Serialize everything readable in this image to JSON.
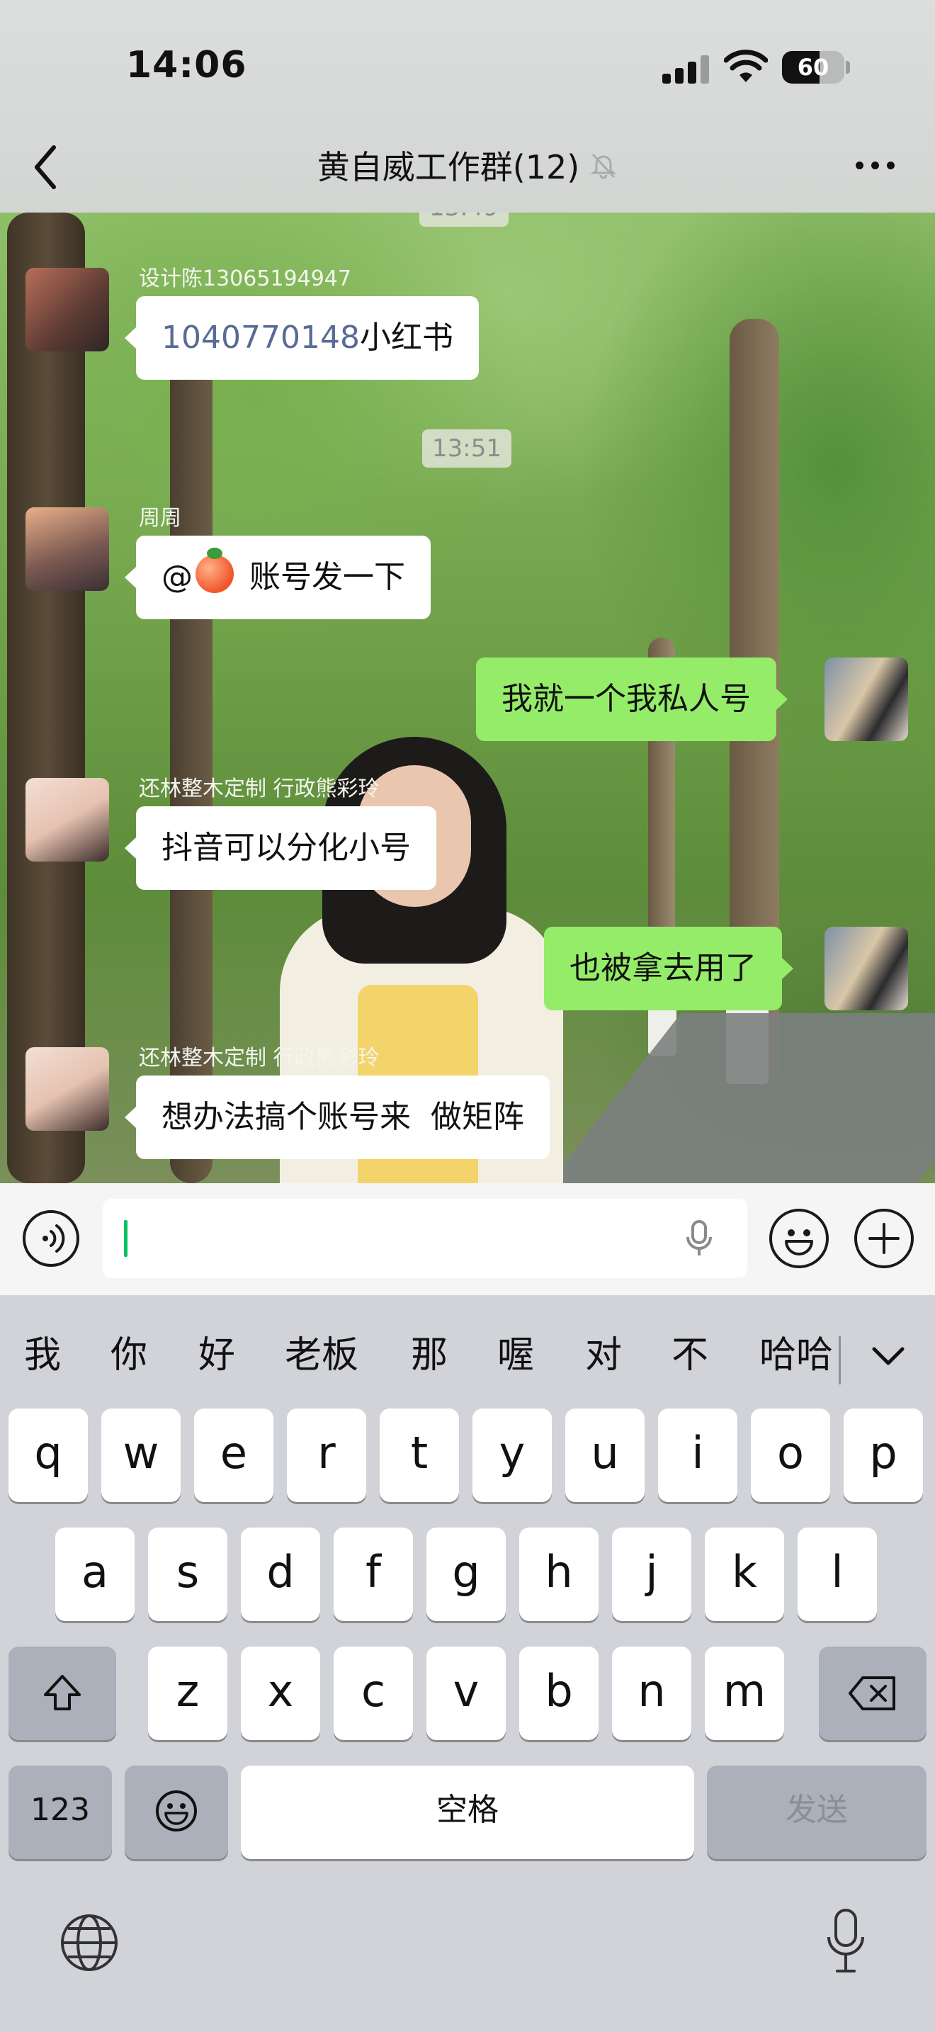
{
  "status_bar": {
    "time": "14:06",
    "battery": "60"
  },
  "header": {
    "title": "黄自威工作群(12)"
  },
  "messages": [
    {
      "sender": "设计陈13065194947",
      "text_link": "1040770148",
      "text": "小红书"
    },
    {
      "sender": "周周",
      "mention": "@",
      "text": " 账号发一下"
    },
    {
      "text": "我就一个我私人号"
    },
    {
      "sender": "还林整木定制 行政熊彩玲",
      "text": "抖音可以分化小号"
    },
    {
      "text": "也被拿去用了"
    },
    {
      "sender": "还林整木定制 行政熊彩玲",
      "text": "想办法搞个账号来  做矩阵"
    }
  ],
  "timestamps": {
    "top_partial": "13:49",
    "middle": "13:51"
  },
  "input": {
    "value": ""
  },
  "keyboard": {
    "candidates": [
      "我",
      "你",
      "好",
      "老板",
      "那",
      "喔",
      "对",
      "不",
      "哈哈"
    ],
    "row1": [
      "q",
      "w",
      "e",
      "r",
      "t",
      "y",
      "u",
      "i",
      "o",
      "p"
    ],
    "row2": [
      "a",
      "s",
      "d",
      "f",
      "g",
      "h",
      "j",
      "k",
      "l"
    ],
    "row3": [
      "z",
      "x",
      "c",
      "v",
      "b",
      "n",
      "m"
    ],
    "numbers_label": "123",
    "space_label": "空格",
    "send_label": "发送"
  },
  "colors": {
    "outgoing_bubble": "#95ec69",
    "incoming_bubble": "#ffffff",
    "link_text": "#576b95",
    "caret": "#07c160"
  },
  "icons": [
    "back-chevron-icon",
    "mute-bell-icon",
    "more-dots-icon",
    "voice-icon",
    "microphone-icon",
    "emoji-icon",
    "plus-icon",
    "shift-icon",
    "backspace-icon",
    "emoji-key-icon",
    "globe-icon",
    "chevron-down-icon"
  ]
}
